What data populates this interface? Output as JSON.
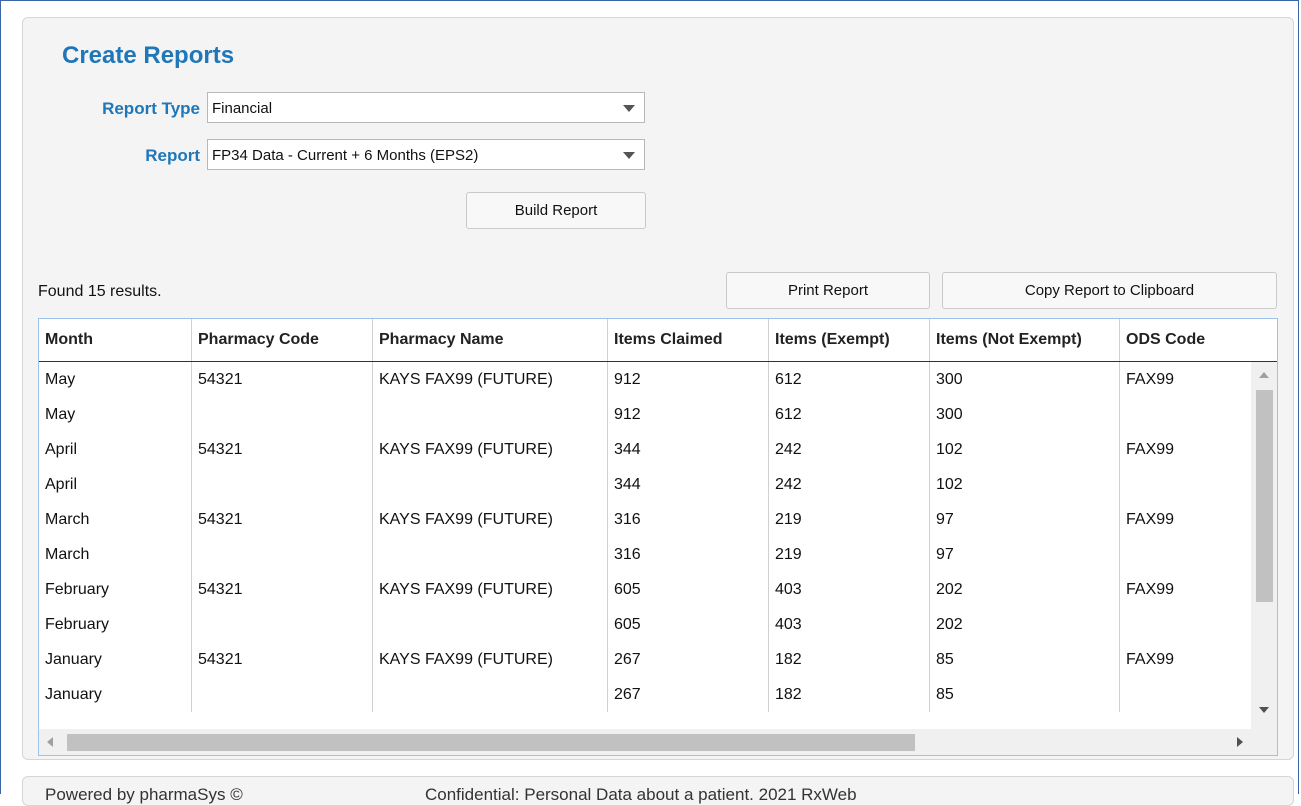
{
  "title": "Create Reports",
  "report_type": {
    "label": "Report Type",
    "value": "Financial"
  },
  "report": {
    "label": "Report",
    "value": "FP34 Data - Current + 6 Months (EPS2)"
  },
  "build_button": "Build Report",
  "print_button": "Print Report",
  "copy_button": "Copy Report to Clipboard",
  "results_text": "Found 15 results.",
  "table": {
    "columns": [
      "Month",
      "Pharmacy Code",
      "Pharmacy Name",
      "Items Claimed",
      "Items (Exempt)",
      "Items (Not Exempt)",
      "ODS Code"
    ],
    "rows": [
      [
        "May",
        "54321",
        "KAYS FAX99 (FUTURE)",
        "912",
        "612",
        "300",
        "FAX99"
      ],
      [
        "May",
        "",
        "",
        "912",
        "612",
        "300",
        ""
      ],
      [
        "April",
        "54321",
        "KAYS FAX99 (FUTURE)",
        "344",
        "242",
        "102",
        "FAX99"
      ],
      [
        "April",
        "",
        "",
        "344",
        "242",
        "102",
        ""
      ],
      [
        "March",
        "54321",
        "KAYS FAX99 (FUTURE)",
        "316",
        "219",
        "97",
        "FAX99"
      ],
      [
        "March",
        "",
        "",
        "316",
        "219",
        "97",
        ""
      ],
      [
        "February",
        "54321",
        "KAYS FAX99 (FUTURE)",
        "605",
        "403",
        "202",
        "FAX99"
      ],
      [
        "February",
        "",
        "",
        "605",
        "403",
        "202",
        ""
      ],
      [
        "January",
        "54321",
        "KAYS FAX99 (FUTURE)",
        "267",
        "182",
        "85",
        "FAX99"
      ],
      [
        "January",
        "",
        "",
        "267",
        "182",
        "85",
        ""
      ]
    ]
  },
  "footer": {
    "left": "Powered by pharmaSys ©",
    "right": "Confidential: Personal Data about a patient. 2021 RxWeb"
  }
}
